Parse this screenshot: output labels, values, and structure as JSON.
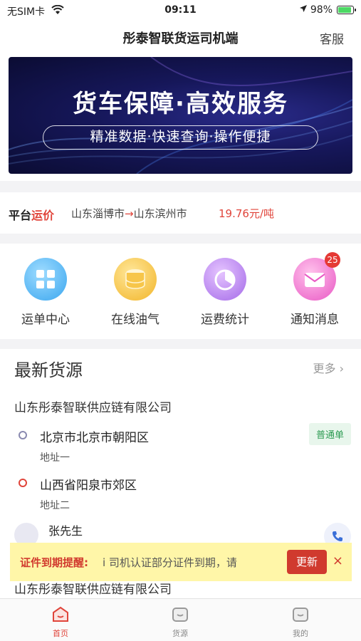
{
  "status_bar": {
    "carrier": "无SIM卡",
    "time": "09:11",
    "battery": "98%"
  },
  "nav": {
    "title": "彤泰智联货运司机端",
    "service": "客服"
  },
  "banner": {
    "title": "货车保障·高效服务",
    "subtitle": "精准数据·快速查询·操作便捷"
  },
  "price": {
    "label_prefix": "平台",
    "label_highlight": "运价",
    "from": "山东淄博市",
    "arrow": "→",
    "to": "山东滨州市",
    "value": "19.76元/吨"
  },
  "quick_icons": [
    {
      "label": "运单中心",
      "icon": "grid-icon"
    },
    {
      "label": "在线油气",
      "icon": "fuel-icon"
    },
    {
      "label": "运费统计",
      "icon": "pie-chart-icon"
    },
    {
      "label": "通知消息",
      "icon": "mail-icon",
      "badge": "25"
    }
  ],
  "cargo": {
    "title": "最新货源",
    "more": "更多",
    "company": "山东彤泰智联供应链有限公司",
    "from_addr": "北京市北京市朝阳区",
    "from_sub": "地址一",
    "to_addr": "山西省阳泉市郊区",
    "to_sub": "地址二",
    "tag": "普通单",
    "contact": "张先生",
    "company2": "山东彤泰智联供应链有限公司"
  },
  "reminder": {
    "label": "证件到期提醒:",
    "text": "i     司机认证部分证件到期，请",
    "button": "更新",
    "close": "×"
  },
  "tabs": [
    {
      "label": "首页",
      "active": true
    },
    {
      "label": "货源",
      "active": false
    },
    {
      "label": "我的",
      "active": false
    }
  ],
  "colors": {
    "accent": "#e0443a",
    "tag_green": "#2d9b52",
    "reminder_bg": "#fff6a8"
  }
}
